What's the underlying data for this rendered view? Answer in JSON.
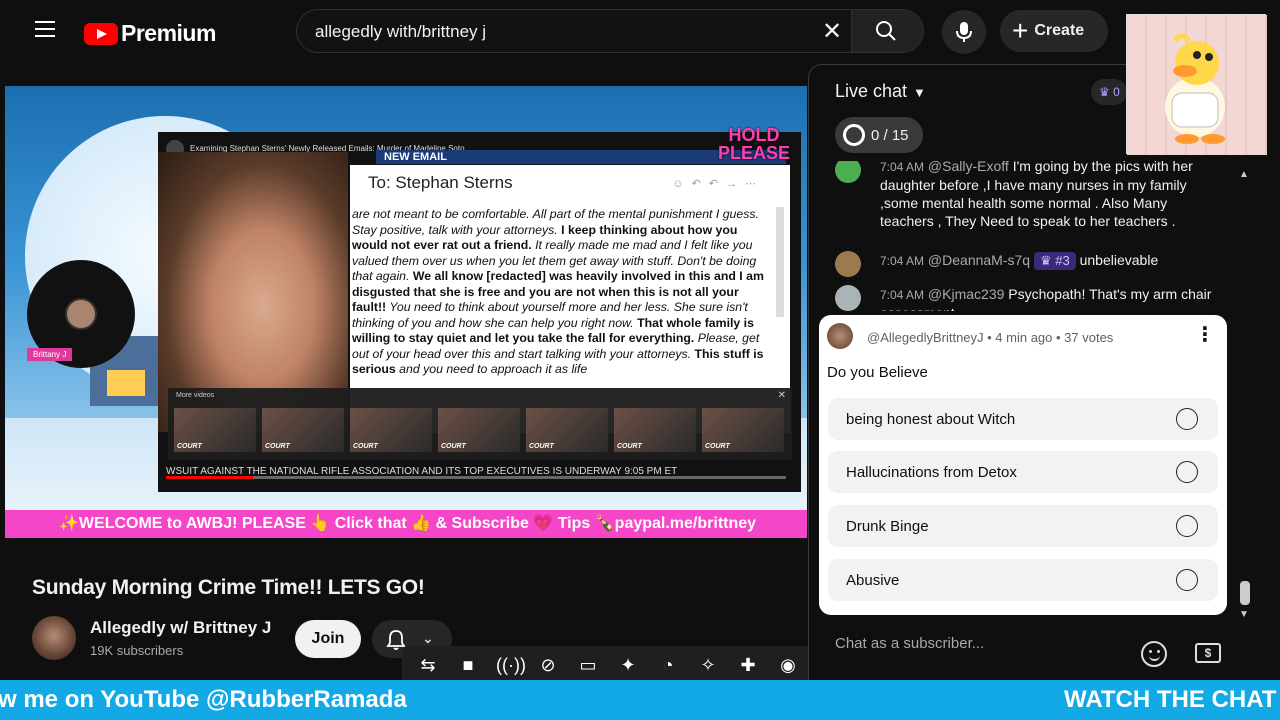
{
  "header": {
    "logo_text": "Premium",
    "search_value": "allegedly with/brittney j",
    "create_label": "Create"
  },
  "video": {
    "inner_title": "Examining Stephan Sterns' Newly Released Emails: Murder of Madeline Soto",
    "hold_please": "HOLD PLEASE",
    "new_email": "NEW EMAIL",
    "email_to": "To: Stephan Sterns",
    "email_lines": [
      "are not meant to be comfortable. All part of the mental punishment I guess. Stay positive, talk with your attorneys.",
      "I keep thinking about how you would not ever rat out a friend.",
      "It really made me mad and I felt like you valued them over us when you let them get away with stuff. Don't be doing that again.",
      "We all know [redacted] was heavily involved in this and I am disgusted that she is free and you are not when this is not all your fault!!",
      "You need to think about yourself more and her less. She sure isn't thinking of you and how she can help you right now.",
      "That whole family is willing to stay quiet and let you take the fall for everything.",
      "Please, get out of your head over this and start talking with your attorneys.",
      "This stuff is serious",
      "and you need to approach it as life"
    ],
    "more_videos_label": "More videos",
    "thumb_tag": "COURT",
    "ticker": "WSUIT AGAINST THE NATIONAL RIFLE ASSOCIATION AND ITS TOP EXECUTIVES IS UNDERWAY   9:05 PM ET",
    "side_tag": "Brittany J",
    "banner": "✨WELCOME to AWBJ! PLEASE 👆 Click that 👍 & Subscribe 💗 Tips 🍾paypal.me/brittney"
  },
  "below_video": {
    "title": "Sunday Morning Crime Time!! LETS GO!",
    "channel_name": "Allegedly w/ Brittney J",
    "subscribers": "19K subscribers",
    "join_label": "Join"
  },
  "chat": {
    "header": "Live chat",
    "crown_count": "0",
    "goal": "0 / 15",
    "messages": [
      {
        "time": "7:04 AM",
        "author": "@Sally-Exoff",
        "text": "I'm going by the pics with her daughter before ,I have many nurses in my family ,some mental health some normal . Also Many teachers , They Need to speak to her teachers ."
      },
      {
        "time": "7:04 AM",
        "author": "@DeannaM-s7q",
        "badge": "#3",
        "text": "unbelievable"
      },
      {
        "time": "7:04 AM",
        "author": "@Kjmac239",
        "text": "Psychopath! That's my arm chair assessment"
      }
    ],
    "input_placeholder": "Chat as a subscriber...",
    "poll": {
      "meta": "@AllegedlyBrittneyJ • 4 min ago • 37 votes",
      "question": "Do you Believe",
      "options": [
        "being honest about Witch",
        "Hallucinations from Detox",
        "Drunk Binge",
        "Abusive"
      ]
    }
  },
  "bottom_ticker": {
    "left": "w me on YouTube @RubberRamada",
    "right": "WATCH THE CHAT"
  },
  "colors": {
    "accent_red": "#ff0000",
    "banner_pink": "#f545c9",
    "ticker_blue": "#12a9e6"
  }
}
